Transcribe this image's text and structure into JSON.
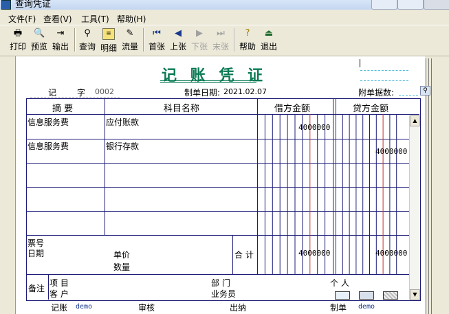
{
  "window": {
    "title": "查询凭证"
  },
  "menu": [
    "文件(F)",
    "查看(V)",
    "工具(T)",
    "帮助(H)"
  ],
  "toolbar": {
    "print": "打印",
    "preview": "预览",
    "export": "输出",
    "query": "查询",
    "detail": "明细",
    "flow": "流量",
    "first": "首张",
    "prev": "上张",
    "next": "下张",
    "last": "末张",
    "help": "帮助",
    "exit": "退出"
  },
  "voucher": {
    "title": "记 账 凭 证",
    "type_label": "记",
    "number_label": "字",
    "number": "0002",
    "date_label": "制单日期:",
    "date": "2021.02.07",
    "attachments_label": "附单据数:",
    "headers": {
      "summary": "摘  要",
      "account": "科目名称",
      "debit": "借方金额",
      "credit": "贷方金额"
    },
    "rows": [
      {
        "summary": "信息服务费",
        "account": "应付账款",
        "debit": "4000000",
        "credit": ""
      },
      {
        "summary": "信息服务费",
        "account": "银行存款",
        "debit": "",
        "credit": "4000000"
      }
    ],
    "ticket_label": "票号",
    "date_row_label": "日期",
    "unit_price_label": "单价",
    "quantity_label": "数量",
    "total_label": "合 计",
    "total_debit": "4000000",
    "total_credit": "4000000",
    "remarks_label": "备注",
    "project_label": "项  目",
    "customer_label": "客  户",
    "department_label": "部  门",
    "salesperson_label": "业务员",
    "person_label": "个  人",
    "footer": {
      "bookkeeping_label": "记账",
      "bookkeeping_value": "demo",
      "review_label": "审核",
      "cashier_label": "出纳",
      "maker_label": "制单",
      "maker_value": "demo"
    }
  },
  "colors": {
    "title_green": "#0a7a55",
    "grid_navy": "#1d1d78",
    "red_line": "#c03030",
    "dash_blue": "#4fb8d8"
  }
}
